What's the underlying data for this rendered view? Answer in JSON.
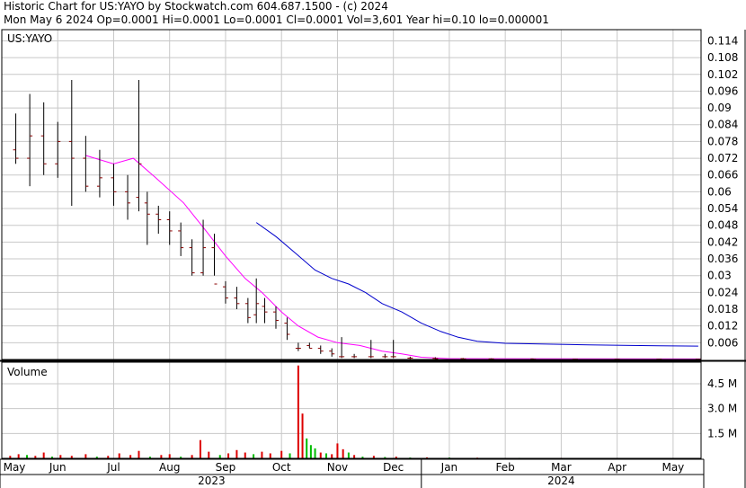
{
  "header": {
    "line1": "Historic Chart for US:YAYO by Stockwatch.com 604.687.1500 - (c) 2024",
    "line2": "Mon May  6 2024   Op=0.0001   Hi=0.0001   Lo=0.0001   Cl=0.0001   Vol=3,601   Year hi=0.10   lo=0.000001"
  },
  "colors": {
    "price_bar": "#8b0000",
    "ma_short": "#ff00ff",
    "ma_long": "#0000cc",
    "vol_up": "#00bb00",
    "vol_down": "#dd0000",
    "grid": "#c8c8c8",
    "frame": "#000000"
  },
  "chart_data": {
    "type": "bar",
    "price_panel": {
      "label": "US:YAYO",
      "y_ticks": [
        "0.114",
        "0.108",
        "0.102",
        "0.096",
        "0.09",
        "0.084",
        "0.078",
        "0.072",
        "0.066",
        "0.06",
        "0.054",
        "0.048",
        "0.042",
        "0.036",
        "0.03",
        "0.024",
        "0.018",
        "0.012",
        "0.006"
      ],
      "ylim": [
        0,
        0.118
      ],
      "ohlc_weekly": [
        {
          "x": 0.5,
          "o": 0.075,
          "h": 0.088,
          "l": 0.07,
          "c": 0.072
        },
        {
          "x": 1.0,
          "o": 0.072,
          "h": 0.095,
          "l": 0.062,
          "c": 0.08
        },
        {
          "x": 1.5,
          "o": 0.08,
          "h": 0.092,
          "l": 0.066,
          "c": 0.07
        },
        {
          "x": 2.0,
          "o": 0.07,
          "h": 0.085,
          "l": 0.065,
          "c": 0.078
        },
        {
          "x": 2.5,
          "o": 0.078,
          "h": 0.1,
          "l": 0.055,
          "c": 0.072
        },
        {
          "x": 3.0,
          "o": 0.072,
          "h": 0.08,
          "l": 0.06,
          "c": 0.062
        },
        {
          "x": 3.5,
          "o": 0.062,
          "h": 0.075,
          "l": 0.058,
          "c": 0.065
        },
        {
          "x": 4.0,
          "o": 0.065,
          "h": 0.07,
          "l": 0.055,
          "c": 0.06
        },
        {
          "x": 4.5,
          "o": 0.06,
          "h": 0.066,
          "l": 0.05,
          "c": 0.056
        },
        {
          "x": 4.9,
          "o": 0.058,
          "h": 0.1,
          "l": 0.053,
          "c": 0.07
        },
        {
          "x": 5.2,
          "o": 0.056,
          "h": 0.06,
          "l": 0.041,
          "c": 0.052
        },
        {
          "x": 5.6,
          "o": 0.052,
          "h": 0.055,
          "l": 0.045,
          "c": 0.05
        },
        {
          "x": 6.0,
          "o": 0.05,
          "h": 0.053,
          "l": 0.041,
          "c": 0.046
        },
        {
          "x": 6.4,
          "o": 0.046,
          "h": 0.049,
          "l": 0.037,
          "c": 0.04
        },
        {
          "x": 6.8,
          "o": 0.04,
          "h": 0.043,
          "l": 0.03,
          "c": 0.031
        },
        {
          "x": 7.2,
          "o": 0.031,
          "h": 0.05,
          "l": 0.03,
          "c": 0.04
        },
        {
          "x": 7.6,
          "o": 0.04,
          "h": 0.045,
          "l": 0.03,
          "c": 0.027
        },
        {
          "x": 8.0,
          "o": 0.026,
          "h": 0.028,
          "l": 0.02,
          "c": 0.022
        },
        {
          "x": 8.4,
          "o": 0.022,
          "h": 0.026,
          "l": 0.018,
          "c": 0.02
        },
        {
          "x": 8.8,
          "o": 0.02,
          "h": 0.022,
          "l": 0.013,
          "c": 0.015
        },
        {
          "x": 9.1,
          "o": 0.016,
          "h": 0.029,
          "l": 0.013,
          "c": 0.02
        },
        {
          "x": 9.4,
          "o": 0.019,
          "h": 0.022,
          "l": 0.013,
          "c": 0.017
        },
        {
          "x": 9.8,
          "o": 0.017,
          "h": 0.019,
          "l": 0.011,
          "c": 0.014
        },
        {
          "x": 10.2,
          "o": 0.013,
          "h": 0.015,
          "l": 0.007,
          "c": 0.009
        },
        {
          "x": 10.6,
          "o": 0.004,
          "h": 0.006,
          "l": 0.003,
          "c": 0.004
        },
        {
          "x": 11.0,
          "o": 0.005,
          "h": 0.006,
          "l": 0.004,
          "c": 0.004
        },
        {
          "x": 11.4,
          "o": 0.004,
          "h": 0.005,
          "l": 0.002,
          "c": 0.003
        },
        {
          "x": 11.8,
          "o": 0.003,
          "h": 0.004,
          "l": 0.001,
          "c": 0.002
        },
        {
          "x": 12.15,
          "o": 0.001,
          "h": 0.008,
          "l": 0.0005,
          "c": 0.001
        },
        {
          "x": 12.6,
          "o": 0.001,
          "h": 0.002,
          "l": 0.0005,
          "c": 0.001
        },
        {
          "x": 13.2,
          "o": 0.001,
          "h": 0.007,
          "l": 0.0005,
          "c": 0.001
        },
        {
          "x": 13.7,
          "o": 0.001,
          "h": 0.002,
          "l": 0.0005,
          "c": 0.001
        },
        {
          "x": 14.0,
          "o": 0.001,
          "h": 0.007,
          "l": 0.0005,
          "c": 0.001
        },
        {
          "x": 14.6,
          "o": 0.0005,
          "h": 0.001,
          "l": 0.0002,
          "c": 0.0005
        },
        {
          "x": 15.5,
          "o": 0.0004,
          "h": 0.0008,
          "l": 0.0002,
          "c": 0.0003
        },
        {
          "x": 16.5,
          "o": 0.0003,
          "h": 0.0005,
          "l": 0.0001,
          "c": 0.0002
        },
        {
          "x": 17.5,
          "o": 0.0002,
          "h": 0.0004,
          "l": 0.0001,
          "c": 0.0002
        },
        {
          "x": 19.0,
          "o": 0.0002,
          "h": 0.0003,
          "l": 0.0001,
          "c": 0.0001
        },
        {
          "x": 20.5,
          "o": 0.0001,
          "h": 0.0002,
          "l": 0.0001,
          "c": 0.0001
        },
        {
          "x": 22.0,
          "o": 0.0001,
          "h": 0.0002,
          "l": 0.0001,
          "c": 0.0001
        },
        {
          "x": 23.5,
          "o": 0.0001,
          "h": 0.0002,
          "l": 0.0001,
          "c": 0.0001
        },
        {
          "x": 24.9,
          "o": 0.0001,
          "h": 0.0001,
          "l": 0.0001,
          "c": 0.0001
        }
      ],
      "ma_short": [
        [
          3.0,
          0.073
        ],
        [
          4.0,
          0.07
        ],
        [
          4.7,
          0.072
        ],
        [
          5.5,
          0.065
        ],
        [
          6.5,
          0.056
        ],
        [
          7.3,
          0.046
        ],
        [
          8.0,
          0.037
        ],
        [
          8.7,
          0.029
        ],
        [
          9.3,
          0.024
        ],
        [
          10.0,
          0.017
        ],
        [
          10.6,
          0.012
        ],
        [
          11.3,
          0.008
        ],
        [
          12.0,
          0.006
        ],
        [
          12.8,
          0.005
        ],
        [
          13.6,
          0.003
        ],
        [
          14.3,
          0.002
        ],
        [
          15.0,
          0.0008
        ],
        [
          16.0,
          0.0003
        ],
        [
          25.0,
          0.0002
        ]
      ],
      "ma_long": [
        [
          9.1,
          0.049
        ],
        [
          9.8,
          0.044
        ],
        [
          10.5,
          0.038
        ],
        [
          11.2,
          0.032
        ],
        [
          11.8,
          0.029
        ],
        [
          12.4,
          0.027
        ],
        [
          13.0,
          0.024
        ],
        [
          13.6,
          0.02
        ],
        [
          14.3,
          0.017
        ],
        [
          15.0,
          0.013
        ],
        [
          15.7,
          0.01
        ],
        [
          16.3,
          0.008
        ],
        [
          17.0,
          0.0065
        ],
        [
          18.0,
          0.0058
        ],
        [
          19.5,
          0.0055
        ],
        [
          21.0,
          0.0052
        ],
        [
          22.5,
          0.005
        ],
        [
          23.5,
          0.0049
        ],
        [
          24.9,
          0.0048
        ]
      ]
    },
    "volume_panel": {
      "label": "Volume",
      "y_ticks": [
        "4.5 M",
        "3.0 M",
        "1.5 M"
      ],
      "ylim": [
        0,
        5.8
      ],
      "bars": [
        {
          "x": 0.3,
          "v": 0.15,
          "up": false
        },
        {
          "x": 0.6,
          "v": 0.25,
          "up": false
        },
        {
          "x": 0.9,
          "v": 0.2,
          "up": true
        },
        {
          "x": 1.2,
          "v": 0.15,
          "up": false
        },
        {
          "x": 1.5,
          "v": 0.35,
          "up": false
        },
        {
          "x": 1.8,
          "v": 0.1,
          "up": true
        },
        {
          "x": 2.1,
          "v": 0.2,
          "up": false
        },
        {
          "x": 2.5,
          "v": 0.15,
          "up": false
        },
        {
          "x": 3.0,
          "v": 0.25,
          "up": false
        },
        {
          "x": 3.4,
          "v": 0.1,
          "up": true
        },
        {
          "x": 3.8,
          "v": 0.15,
          "up": false
        },
        {
          "x": 4.2,
          "v": 0.3,
          "up": false
        },
        {
          "x": 4.6,
          "v": 0.2,
          "up": false
        },
        {
          "x": 4.9,
          "v": 0.45,
          "up": false
        },
        {
          "x": 5.3,
          "v": 0.1,
          "up": true
        },
        {
          "x": 5.7,
          "v": 0.2,
          "up": false
        },
        {
          "x": 6.0,
          "v": 0.25,
          "up": false
        },
        {
          "x": 6.4,
          "v": 0.1,
          "up": true
        },
        {
          "x": 6.8,
          "v": 0.2,
          "up": false
        },
        {
          "x": 7.1,
          "v": 1.1,
          "up": false
        },
        {
          "x": 7.4,
          "v": 0.4,
          "up": false
        },
        {
          "x": 7.8,
          "v": 0.2,
          "up": true
        },
        {
          "x": 8.1,
          "v": 0.3,
          "up": false
        },
        {
          "x": 8.4,
          "v": 0.5,
          "up": false
        },
        {
          "x": 8.7,
          "v": 0.35,
          "up": false
        },
        {
          "x": 9.0,
          "v": 0.25,
          "up": true
        },
        {
          "x": 9.3,
          "v": 0.4,
          "up": false
        },
        {
          "x": 9.6,
          "v": 0.3,
          "up": false
        },
        {
          "x": 10.0,
          "v": 0.45,
          "up": false
        },
        {
          "x": 10.3,
          "v": 0.3,
          "up": true
        },
        {
          "x": 10.6,
          "v": 5.6,
          "up": false
        },
        {
          "x": 10.75,
          "v": 2.7,
          "up": false
        },
        {
          "x": 10.9,
          "v": 1.2,
          "up": true
        },
        {
          "x": 11.05,
          "v": 0.8,
          "up": true
        },
        {
          "x": 11.2,
          "v": 0.6,
          "up": true
        },
        {
          "x": 11.4,
          "v": 0.35,
          "up": false
        },
        {
          "x": 11.6,
          "v": 0.3,
          "up": true
        },
        {
          "x": 11.8,
          "v": 0.25,
          "up": false
        },
        {
          "x": 12.0,
          "v": 0.9,
          "up": false
        },
        {
          "x": 12.2,
          "v": 0.55,
          "up": false
        },
        {
          "x": 12.4,
          "v": 0.35,
          "up": true
        },
        {
          "x": 12.6,
          "v": 0.2,
          "up": false
        },
        {
          "x": 12.9,
          "v": 0.1,
          "up": true
        },
        {
          "x": 13.3,
          "v": 0.15,
          "up": false
        },
        {
          "x": 13.7,
          "v": 0.08,
          "up": true
        },
        {
          "x": 14.1,
          "v": 0.1,
          "up": false
        },
        {
          "x": 14.6,
          "v": 0.05,
          "up": true
        },
        {
          "x": 15.2,
          "v": 0.06,
          "up": false
        },
        {
          "x": 16.0,
          "v": 0.05,
          "up": true
        },
        {
          "x": 17.0,
          "v": 0.04,
          "up": false
        },
        {
          "x": 18.5,
          "v": 0.03,
          "up": true
        },
        {
          "x": 20.0,
          "v": 0.03,
          "up": false
        },
        {
          "x": 22.0,
          "v": 0.02,
          "up": true
        },
        {
          "x": 24.0,
          "v": 0.02,
          "up": false
        }
      ]
    },
    "x_axis": {
      "months": [
        "May",
        "Jun",
        "Jul",
        "Aug",
        "Sep",
        "Oct",
        "Nov",
        "Dec",
        "Jan",
        "Feb",
        "Mar",
        "Apr",
        "May"
      ],
      "years": [
        "2023",
        "2024"
      ],
      "year_split_index": 8,
      "xlim": [
        0,
        25
      ]
    },
    "grid": true
  }
}
